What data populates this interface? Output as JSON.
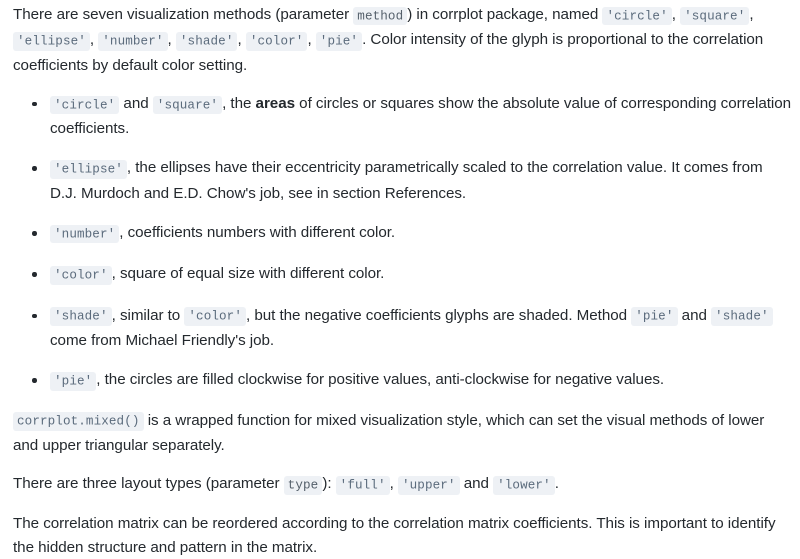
{
  "document": {
    "intro_paragraph": {
      "seg1": "There are seven visualization methods (parameter ",
      "code_method": "method",
      "seg2": ") in corrplot package, named ",
      "code_circle": "'circle'",
      "seg3": ", ",
      "code_square": "'square'",
      "seg4": ", ",
      "code_ellipse": "'ellipse'",
      "seg5": ", ",
      "code_number": "'number'",
      "seg6": ", ",
      "code_shade": "'shade'",
      "seg7": ", ",
      "code_color": "'color'",
      "seg8": ", ",
      "code_pie": "'pie'",
      "seg9": ". Color intensity of the glyph is proportional to the correlation coefficients by default color setting."
    },
    "method_list": [
      {
        "id": "circle-square",
        "code_a": "'circle'",
        "mid1": " and ",
        "code_b": "'square'",
        "mid2": ", the ",
        "bold": "areas",
        "tail": " of circles or squares show the absolute value of corresponding correlation coefficients."
      },
      {
        "id": "ellipse",
        "code_a": "'ellipse'",
        "tail": ", the ellipses have their eccentricity parametrically scaled to the correlation value. It comes from D.J. Murdoch and E.D. Chow's job, see in section References."
      },
      {
        "id": "number",
        "code_a": "'number'",
        "tail": ", coefficients numbers with different color."
      },
      {
        "id": "color",
        "code_a": "'color'",
        "tail": ", square of equal size with different color."
      },
      {
        "id": "shade",
        "code_a": "'shade'",
        "mid1": ", similar to ",
        "code_b": "'color'",
        "mid2": ", but the negative coefficients glyphs are shaded. Method ",
        "code_c": "'pie'",
        "mid3": " and ",
        "code_d": "'shade'",
        "tail": " come from Michael Friendly's job."
      },
      {
        "id": "pie",
        "code_a": "'pie'",
        "tail": ", the circles are filled clockwise for positive values, anti-clockwise for negative values."
      }
    ],
    "mixed_paragraph": {
      "code_fn": "corrplot.mixed()",
      "tail": " is a wrapped function for mixed visualization style, which can set the visual methods of lower and upper triangular separately."
    },
    "layout_paragraph": {
      "seg1": "There are three layout types (parameter ",
      "code_type": "type",
      "seg2": "): ",
      "code_full": "'full'",
      "seg3": ", ",
      "code_upper": "'upper'",
      "seg4": " and ",
      "code_lower": "'lower'",
      "seg5": "."
    },
    "reorder_paragraph": "The correlation matrix can be reordered according to the correlation matrix coefficients. This is important to identify the hidden structure and pattern in the matrix."
  },
  "colors": {
    "background": "#ffffff",
    "text": "#24292e",
    "code_text": "#5b6b7c",
    "code_background": "#eef1f5"
  }
}
